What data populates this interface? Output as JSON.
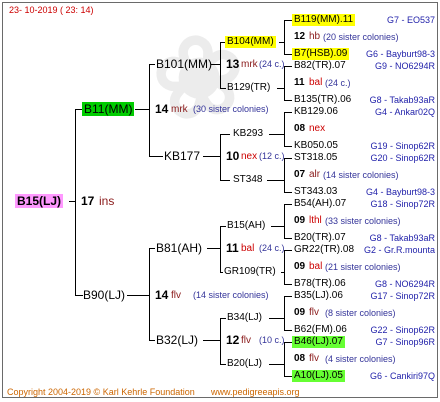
{
  "header": {
    "date": "23- 10-2019 ( 23: 14)"
  },
  "footer": {
    "copyright": "Copyright 2004-2019 © Karl Kehrle Foundation",
    "website": "www.pedigreeapis.org"
  },
  "colors": {
    "queen_bg": "#ff66ff",
    "b11_bg": "#00cc00",
    "yellow_bg": "#ffff00",
    "green_bg": "#66ff33",
    "line": "#000000"
  },
  "root": {
    "name": "B15(LJ)",
    "year": "17",
    "mark": "ins"
  },
  "gen1": [
    {
      "name": "B11(MM)",
      "year": "14",
      "mark": "mrk",
      "note": "(30 sister colonies)"
    },
    {
      "name": "B90(LJ)",
      "year": "14",
      "mark": "flv",
      "note": "(14 sister colonies)"
    }
  ],
  "gen2": [
    {
      "name": "B101(MM)",
      "year": "13",
      "mark": "mrk",
      "note": "(24 c.)"
    },
    {
      "name": "KB177",
      "year": "10",
      "mark": "nex",
      "note": "(12 c.)"
    },
    {
      "name": "B81(AH)",
      "year": "11",
      "mark": "bal",
      "note": "(24 c.)"
    },
    {
      "name": "B32(LJ)",
      "year": "12",
      "mark": "flv",
      "note": "(10 c.)"
    }
  ],
  "gen3": [
    {
      "name": "B104(MM)",
      "year": "12",
      "mark": "hb",
      "note": "(20 sister colonies)"
    },
    {
      "name": "B129(TR)",
      "year": "08",
      "mark": "nex",
      "note": ""
    },
    {
      "name": "KB293",
      "year": "07",
      "mark": "alr",
      "note": "(14 sister colonies)"
    },
    {
      "name": "ST348",
      "year": "11",
      "mark": "bal",
      "note": "(24 c.)"
    },
    {
      "name": "B15(AH)",
      "year": "09",
      "mark": "lthl",
      "note": "(33 sister colonies)"
    },
    {
      "name": "GR109(TR)",
      "year": "09",
      "mark": "bal",
      "note": "(21 sister colonies)"
    },
    {
      "name": "B34(LJ)",
      "year": "09",
      "mark": "flv",
      "note": "(8 sister colonies)"
    },
    {
      "name": "B20(LJ)",
      "year": "08",
      "mark": "flv",
      "note": "(4 sister colonies)"
    }
  ],
  "gen4": [
    {
      "name": "B119(MM).11",
      "code": "G7 - EO537"
    },
    {
      "name": "B7(HSB).09",
      "code": "G6 - Bayburt98-3"
    },
    {
      "name": "B82(TR).07",
      "code": "G9 - NO6294R"
    },
    {
      "name": "B135(TR).06",
      "code": "G8 - Takab93aR"
    },
    {
      "name": "KB129.06",
      "code": "G4 - Ankar02Q"
    },
    {
      "name": "KB050.05",
      "code": "G19 - Sinop62R"
    },
    {
      "name": "ST318.05",
      "code": "G20 - Sinop62R"
    },
    {
      "name": "ST343.03",
      "code": "G4 - Bayburt98-3"
    },
    {
      "name": "B54(AH).07",
      "code": "G18 - Sinop72R"
    },
    {
      "name": "B20(TR).07",
      "code": "G8 - Takab93aR"
    },
    {
      "name": "GR22(TR).08",
      "code": "G2 - Gr.R.mounta"
    },
    {
      "name": "B78(TR).06",
      "code": "G8 - NO6294R"
    },
    {
      "name": "B35(LJ).06",
      "code": "G17 - Sinop72R"
    },
    {
      "name": "B62(FM).06",
      "code": "G22 - Sinop62R"
    },
    {
      "name": "B46(LJ).07",
      "code": "G7 - Sinop96R"
    },
    {
      "name": "A10(LJ).05",
      "code": "G6 - Cankiri97Q"
    }
  ]
}
